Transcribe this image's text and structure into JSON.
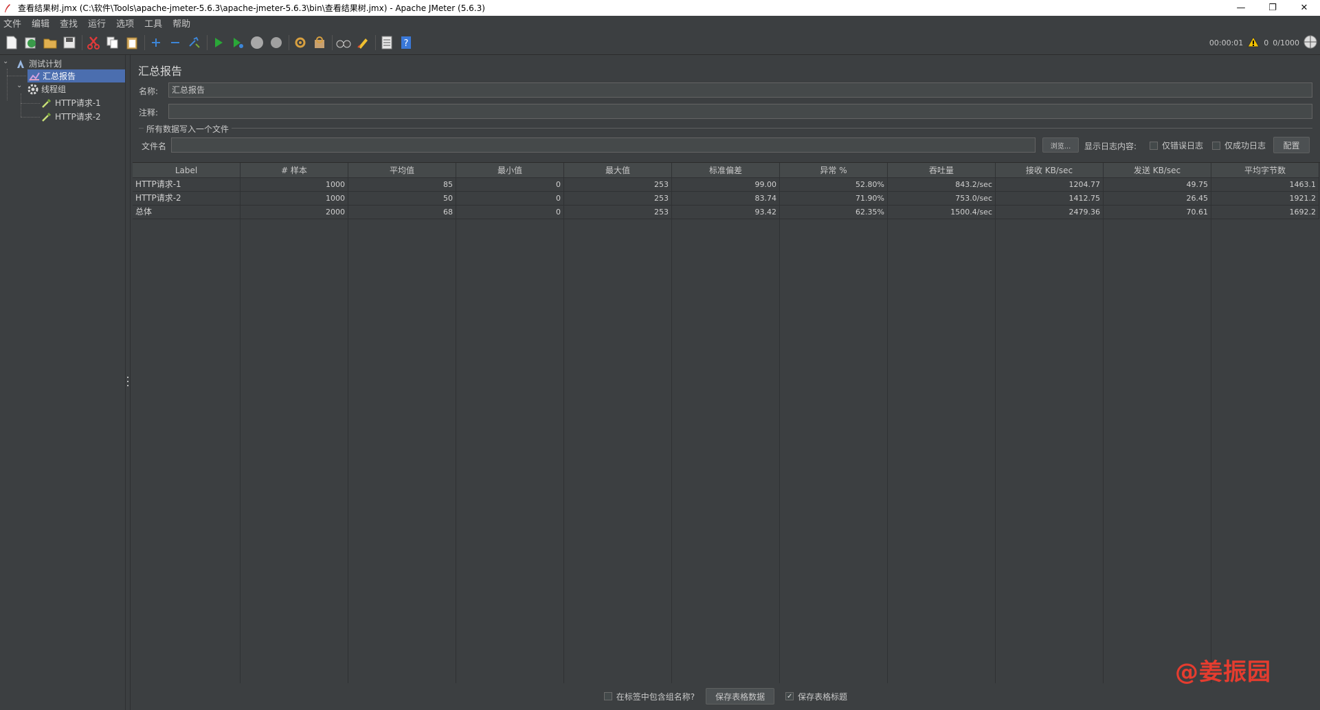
{
  "window": {
    "title": "查看结果树.jmx (C:\\软件\\Tools\\apache-jmeter-5.6.3\\apache-jmeter-5.6.3\\bin\\查看结果树.jmx) - Apache JMeter (5.6.3)",
    "minimize": "—",
    "restore": "❐",
    "close": "✕"
  },
  "menu": [
    "文件",
    "编辑",
    "查找",
    "运行",
    "选项",
    "工具",
    "帮助"
  ],
  "status": {
    "elapsed": "00:00:01",
    "warnings": "0",
    "threads": "0/1000"
  },
  "tree": {
    "root": "测试计划",
    "report": "汇总报告",
    "thread_group": "线程组",
    "req1": "HTTP请求-1",
    "req2": "HTTP请求-2"
  },
  "panel": {
    "title": "汇总报告",
    "name_label": "名称:",
    "name_value": "汇总报告",
    "comment_label": "注释:",
    "comment_value": "",
    "file_group": "所有数据写入一个文件",
    "file_label": "文件名",
    "file_value": "",
    "browse": "浏览...",
    "log_label": "显示日志内容:",
    "errors_only": "仅错误日志",
    "success_only": "仅成功日志",
    "configure": "配置"
  },
  "table": {
    "columns": [
      "Label",
      "# 样本",
      "平均值",
      "最小值",
      "最大值",
      "标准偏差",
      "异常 %",
      "吞吐量",
      "接收 KB/sec",
      "发送 KB/sec",
      "平均字节数"
    ],
    "rows": [
      [
        "HTTP请求-1",
        "1000",
        "85",
        "0",
        "253",
        "99.00",
        "52.80%",
        "843.2/sec",
        "1204.77",
        "49.75",
        "1463.1"
      ],
      [
        "HTTP请求-2",
        "1000",
        "50",
        "0",
        "253",
        "83.74",
        "71.90%",
        "753.0/sec",
        "1412.75",
        "26.45",
        "1921.2"
      ],
      [
        "总体",
        "2000",
        "68",
        "0",
        "253",
        "93.42",
        "62.35%",
        "1500.4/sec",
        "2479.36",
        "70.61",
        "1692.2"
      ]
    ]
  },
  "bottom": {
    "include_group": "在标签中包含组名称?",
    "save_data": "保存表格数据",
    "save_header": "保存表格标题",
    "save_header_checked": "✓"
  },
  "watermark": "@姜振园",
  "colors": {
    "bg": "#3c3f41",
    "selection": "#4b6eaf",
    "watermark": "#e53c2f"
  }
}
